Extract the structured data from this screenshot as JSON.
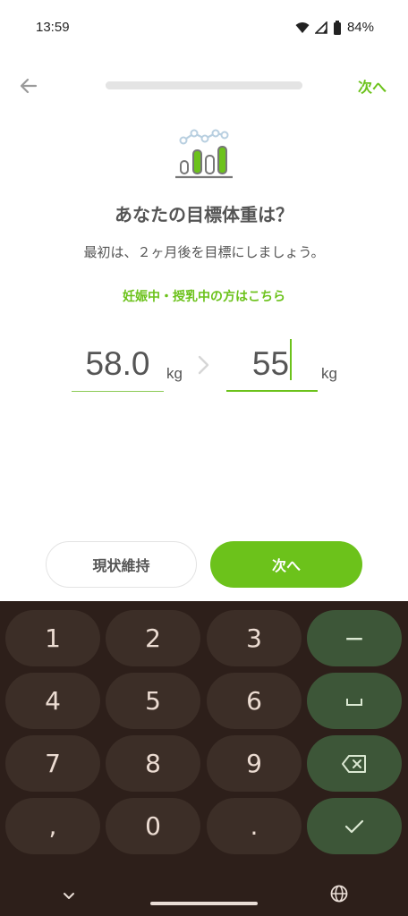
{
  "status_bar": {
    "time": "13:59",
    "battery": "84%"
  },
  "header": {
    "next_label": "次へ",
    "back_icon": "arrow-left-icon",
    "progress_fraction": 1.0
  },
  "main": {
    "title": "あなたの目標体重は？",
    "subtitle": "最初は、２ヶ月後を目標にしましょう。",
    "pregnancy_link": "妊娠中・授乳中の方はこちら",
    "current_weight": "58.0",
    "current_unit": "kg",
    "target_weight": "55",
    "target_unit": "kg"
  },
  "buttons": {
    "keep_label": "現状維持",
    "next_label": "次へ"
  },
  "keyboard": {
    "rows": [
      [
        "1",
        "2",
        "3",
        "−"
      ],
      [
        "4",
        "5",
        "6",
        "␣"
      ],
      [
        "7",
        "8",
        "9",
        "backspace"
      ],
      [
        ",",
        "0",
        ".",
        "done"
      ]
    ],
    "keys": {
      "k1": "1",
      "k2": "2",
      "k3": "3",
      "minus": "−",
      "k4": "4",
      "k5": "5",
      "k6": "6",
      "k7": "7",
      "k8": "8",
      "k9": "9",
      "comma": ",",
      "k0": "0",
      "period": "."
    }
  },
  "colors": {
    "accent": "#6cc21b",
    "keyboard_bg": "#2d1f1a",
    "key_bg": "#3c2e27",
    "action_key_bg": "#3d5638"
  }
}
